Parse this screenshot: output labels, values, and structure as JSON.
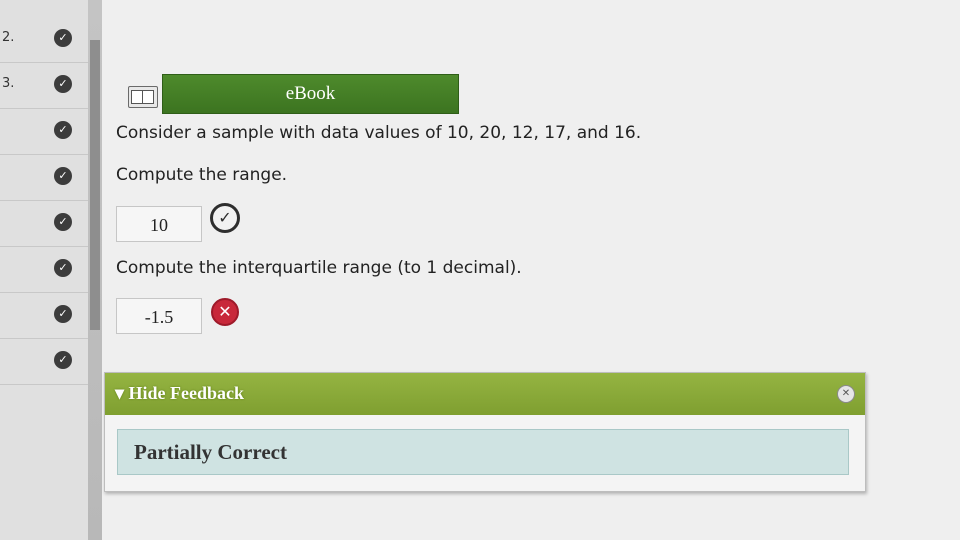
{
  "sidebar": {
    "items": [
      {
        "number": "2.",
        "status": "✓"
      },
      {
        "number": "3.",
        "status": "✓"
      },
      {
        "number": "",
        "status": "✓"
      },
      {
        "number": "",
        "status": "✓"
      },
      {
        "number": "",
        "status": "✓"
      },
      {
        "number": "",
        "status": "✓"
      },
      {
        "number": "",
        "status": "✓"
      },
      {
        "number": "",
        "status": "✓"
      }
    ]
  },
  "ebook": {
    "label": "eBook",
    "icon": "book-icon"
  },
  "question": {
    "prompt": "Consider a sample with data values of 10, 20, 12, 17, and 16.",
    "part1": {
      "text": "Compute the range.",
      "answer": "10",
      "result_icon": "check-icon"
    },
    "part2": {
      "text": "Compute the interquartile range (to 1 decimal).",
      "answer": "-1.5",
      "result_icon": "x-icon"
    }
  },
  "feedback": {
    "toggle_label": "Hide Feedback",
    "result": "Partially Correct"
  },
  "colors": {
    "ebook_bar": "#4e8a2c",
    "feedback_header": "#8aaa38",
    "feedback_result_bg": "#cfe3e2",
    "wrong": "#c8283a"
  }
}
